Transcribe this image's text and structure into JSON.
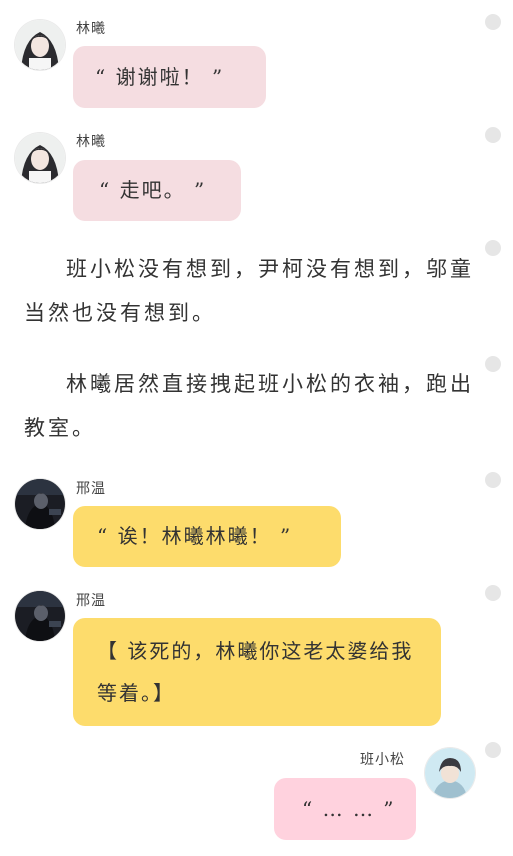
{
  "messages": [
    {
      "speaker": "林曦",
      "text": "“ 谢谢啦！ ”",
      "style": "pink",
      "avatar": "girl-avatar"
    },
    {
      "speaker": "林曦",
      "text": "“ 走吧。 ”",
      "style": "pink",
      "avatar": "girl-avatar"
    },
    {
      "speaker": "邢温",
      "text": "“ 诶！林曦林曦！ ”",
      "style": "yellow",
      "avatar": "dark-avatar"
    },
    {
      "speaker": "邢温",
      "text": "【 该死的，林曦你这老太婆给我等着。】",
      "style": "yellow",
      "avatar": "dark-avatar"
    },
    {
      "speaker": "班小松",
      "text": "“ … … ”",
      "style": "rose",
      "avatar": "boy-avatar"
    }
  ],
  "narration": [
    "班小松没有想到，尹柯没有想到，邬童当然也没有想到。",
    "林曦居然直接拽起班小松的衣袖，跑出教室。"
  ],
  "colors": {
    "pink_bubble": "#f5dde1",
    "yellow_bubble": "#fddc6c",
    "rose_bubble": "#ffd2de",
    "status_dot": "#e6e6e6"
  }
}
